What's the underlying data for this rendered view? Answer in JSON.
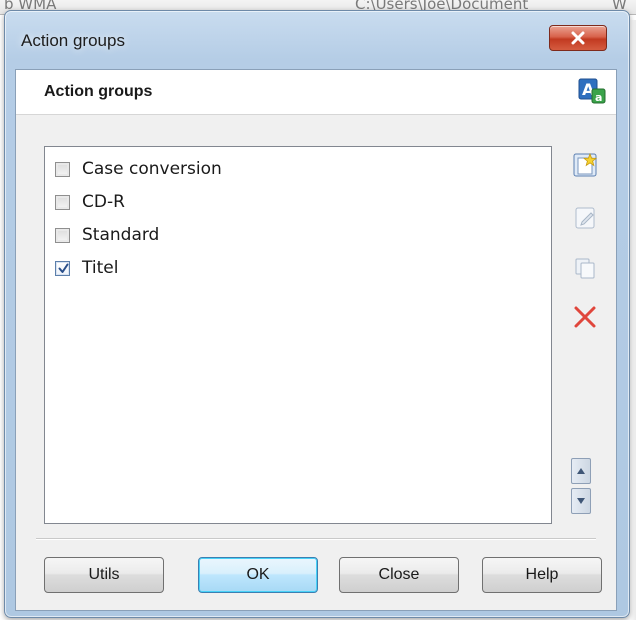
{
  "background_window": {
    "left_text": "b WMA",
    "mid_text": "C:\\Users\\Joe\\Document",
    "right_text": "W"
  },
  "window": {
    "title": "Action groups",
    "close_icon": "close-icon"
  },
  "header": {
    "title": "Action groups",
    "language_icon": "language-icon"
  },
  "action_groups": {
    "items": [
      {
        "label": "Case conversion",
        "checked": false
      },
      {
        "label": "CD-R",
        "checked": false
      },
      {
        "label": "Standard",
        "checked": false
      },
      {
        "label": "Titel",
        "checked": true
      }
    ]
  },
  "tools": {
    "new_icon": "new-star-icon",
    "edit_icon": "edit-icon",
    "copy_icon": "copy-icon",
    "delete_icon": "delete-x-icon",
    "move_up_icon": "arrow-up-icon",
    "move_down_icon": "arrow-down-icon"
  },
  "buttons": {
    "utils": "Utils",
    "ok": "OK",
    "close": "Close",
    "help": "Help"
  },
  "colors": {
    "frame": "#b5cde6",
    "close_button": "#c23a21",
    "default_button_border": "#3c7fb1",
    "delete_red": "#e0463c"
  }
}
